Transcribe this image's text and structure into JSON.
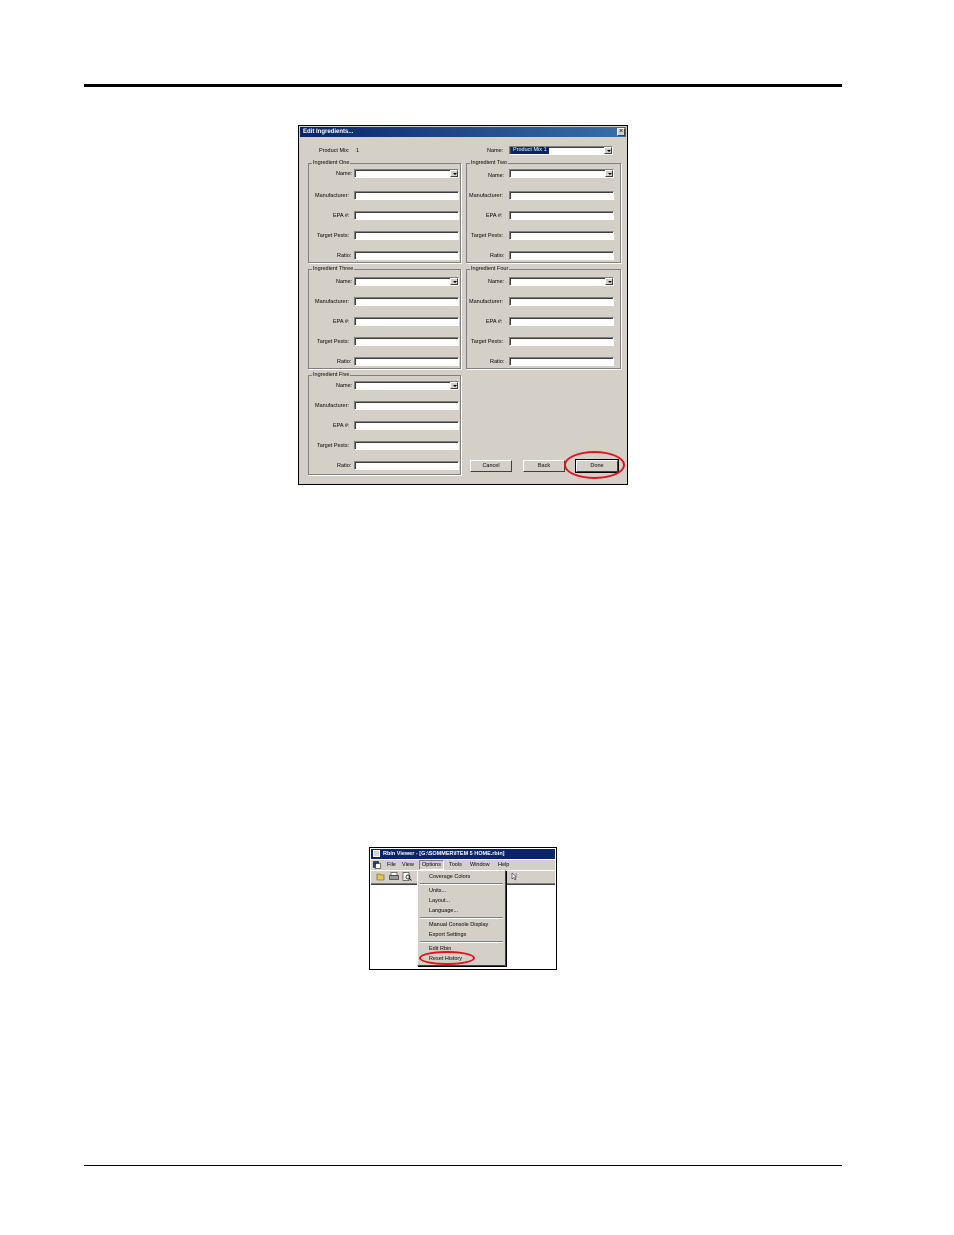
{
  "dialog": {
    "title": "Edit Ingredients...",
    "product_mix_label": "Product Mix:",
    "product_mix_value": "1",
    "name_label": "Name:",
    "name_value": "Product Mix 1",
    "field_labels": {
      "name": "Name:",
      "manufacturer": "Manufacturer:",
      "epa": "EPA #:",
      "target_pests": "Target Pests:",
      "ratio": "Ratio:"
    },
    "groups": [
      {
        "legend": "Ingredient One"
      },
      {
        "legend": "Ingredient Two"
      },
      {
        "legend": "Ingredient Three"
      },
      {
        "legend": "Ingredient Four"
      },
      {
        "legend": "Ingredient Five"
      }
    ],
    "buttons": {
      "cancel": "Cancel",
      "back": "Back",
      "done": "Done"
    },
    "highlight_color": "#e0141e"
  },
  "viewer": {
    "title": "Rbin Viewer - [G:\\SOMMER\\ITEM 5 HOME.rbin]",
    "menu": {
      "file": "File",
      "view": "View",
      "options": "Options",
      "tools": "Tools",
      "window": "Window",
      "help": "Help"
    },
    "options_menu": {
      "coverage_colors": "Coverage Colors",
      "units": "Units...",
      "layout": "Layout...",
      "language": "Language...",
      "manual_console_display": "Manual Console Display",
      "export_settings": "Export Settings",
      "edit_rbin": "Edit Rbin",
      "reset_history": "Reset History"
    }
  }
}
